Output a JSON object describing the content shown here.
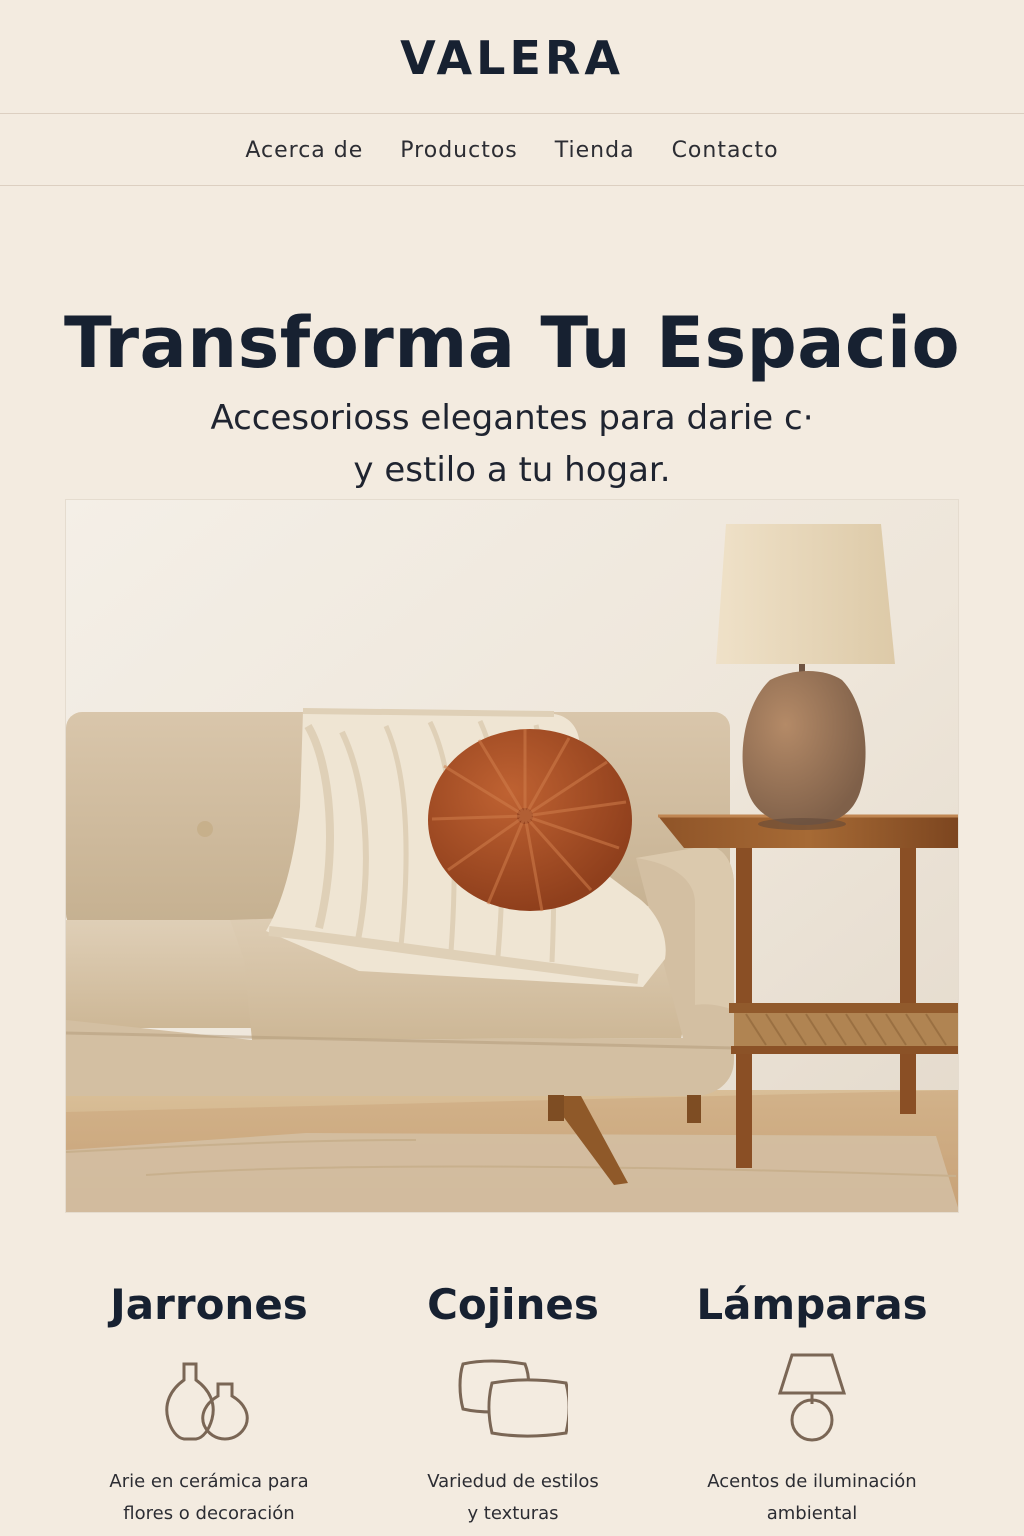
{
  "brand": {
    "name": "VALERA"
  },
  "nav": {
    "items": [
      {
        "label": "Acerca de"
      },
      {
        "label": "Productos"
      },
      {
        "label": "Tienda"
      },
      {
        "label": "Contacto"
      }
    ]
  },
  "hero": {
    "title": "Transforma Tu Espacio",
    "subtitle": "Accesorioss elegantes para darie c·\ny estilo a tu hogar."
  },
  "categories": [
    {
      "title": "Jarrones",
      "description": "Arie en cerámica para\nflores o decoración",
      "icon": "vase-icon"
    },
    {
      "title": "Cojines",
      "description": "Variedud de estilos\ny texturas",
      "icon": "pillow-icon"
    },
    {
      "title": "Lámparas",
      "description": "Acentos de iluminación\nambiental",
      "icon": "lamp-icon"
    }
  ],
  "colors": {
    "background": "#f3ebe0",
    "text": "#172131",
    "icon": "#7a6655"
  }
}
